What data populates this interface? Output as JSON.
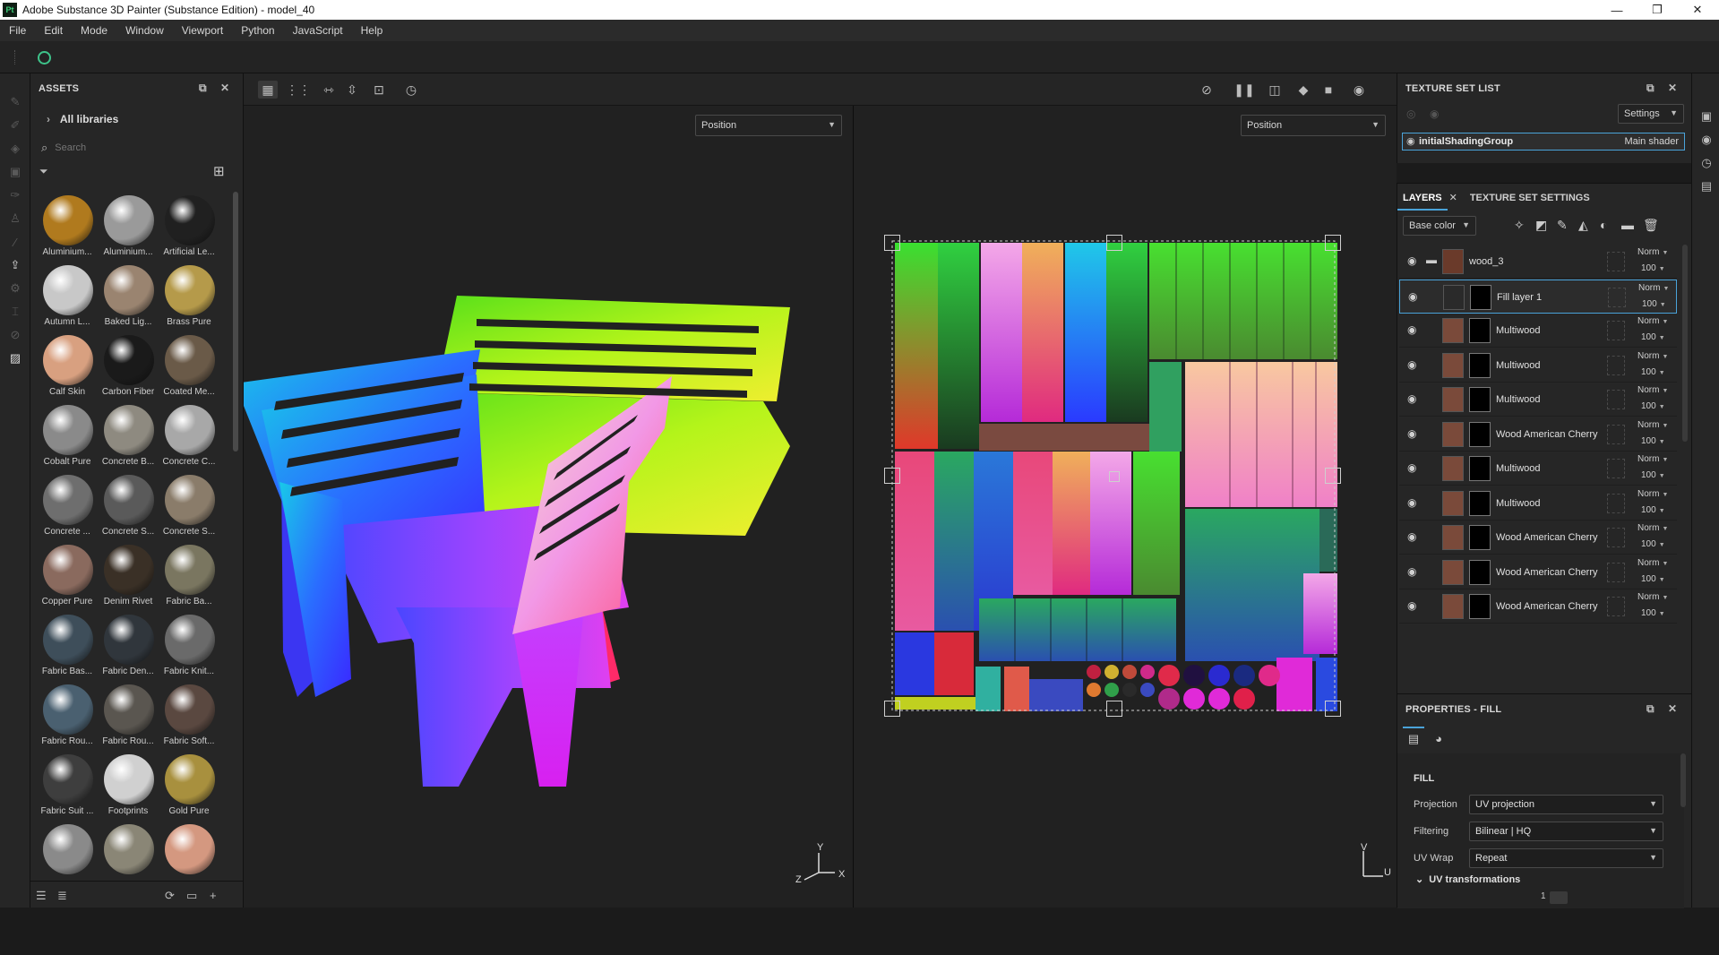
{
  "titlebar": {
    "logo": "Pt",
    "title": "Adobe Substance 3D Painter (Substance Edition) - model_40",
    "minimize": "—",
    "maximize": "❐",
    "close": "✕"
  },
  "menu": [
    "File",
    "Edit",
    "Mode",
    "Window",
    "Viewport",
    "Python",
    "JavaScript",
    "Help"
  ],
  "assets": {
    "title": "ASSETS",
    "library": "All libraries",
    "search_placeholder": "Search",
    "items": [
      {
        "label": "Aluminium...",
        "color": "#b07a1e"
      },
      {
        "label": "Aluminium...",
        "color": "#9a9a9a"
      },
      {
        "label": "Artificial Le...",
        "color": "#202020"
      },
      {
        "label": "Autumn L...",
        "color": "#c8c8c8"
      },
      {
        "label": "Baked Lig...",
        "color": "#9a8470"
      },
      {
        "label": "Brass Pure",
        "color": "#b59a4a"
      },
      {
        "label": "Calf Skin",
        "color": "#d8a080"
      },
      {
        "label": "Carbon Fiber",
        "color": "#1a1a1a"
      },
      {
        "label": "Coated Me...",
        "color": "#6a5a48"
      },
      {
        "label": "Cobalt Pure",
        "color": "#8a8a8a"
      },
      {
        "label": "Concrete B...",
        "color": "#8e8a80"
      },
      {
        "label": "Concrete C...",
        "color": "#a8a8a8"
      },
      {
        "label": "Concrete ...",
        "color": "#6e6e6e"
      },
      {
        "label": "Concrete S...",
        "color": "#5a5a5a"
      },
      {
        "label": "Concrete S...",
        "color": "#8a7c6a"
      },
      {
        "label": "Copper Pure",
        "color": "#8a6a5e"
      },
      {
        "label": "Denim Rivet",
        "color": "#3a3026"
      },
      {
        "label": "Fabric Ba...",
        "color": "#7a7660"
      },
      {
        "label": "Fabric Bas...",
        "color": "#3e4e5a"
      },
      {
        "label": "Fabric Den...",
        "color": "#30363c"
      },
      {
        "label": "Fabric Knit...",
        "color": "#6a6a6a"
      },
      {
        "label": "Fabric Rou...",
        "color": "#4a6070"
      },
      {
        "label": "Fabric Rou...",
        "color": "#5a5650"
      },
      {
        "label": "Fabric Soft...",
        "color": "#5a4840"
      },
      {
        "label": "Fabric Suit ...",
        "color": "#3e3e3e"
      },
      {
        "label": "Footprints",
        "color": "#d0d0d0"
      },
      {
        "label": "Gold Pure",
        "color": "#a8903e"
      },
      {
        "label": "",
        "color": "#8a8a8a"
      },
      {
        "label": "",
        "color": "#8a8676"
      },
      {
        "label": "",
        "color": "#d49880"
      }
    ]
  },
  "viewport": {
    "left_mode": "Position",
    "right_mode": "Position",
    "gizmo_3d": {
      "y": "Y",
      "z": "Z",
      "x": "X"
    },
    "gizmo_2d": {
      "v": "V",
      "u": "U"
    }
  },
  "texture_set_list": {
    "title": "TEXTURE SET LIST",
    "settings": "Settings",
    "set_name": "initialShadingGroup",
    "shader": "Main shader"
  },
  "layers": {
    "tabs": [
      "LAYERS",
      "TEXTURE SET SETTINGS"
    ],
    "channel": "Base color",
    "rows": [
      {
        "name": "wood_3",
        "blend": "Norm",
        "opacity": "100",
        "type": "folder"
      },
      {
        "name": "Fill layer 1",
        "blend": "Norm",
        "opacity": "100",
        "type": "fill"
      },
      {
        "name": "Multiwood",
        "blend": "Norm",
        "opacity": "100",
        "type": "mask"
      },
      {
        "name": "Multiwood",
        "blend": "Norm",
        "opacity": "100",
        "type": "mask"
      },
      {
        "name": "Multiwood",
        "blend": "Norm",
        "opacity": "100",
        "type": "mask"
      },
      {
        "name": "Wood American Cherry",
        "blend": "Norm",
        "opacity": "100",
        "type": "mask"
      },
      {
        "name": "Multiwood",
        "blend": "Norm",
        "opacity": "100",
        "type": "mask"
      },
      {
        "name": "Multiwood",
        "blend": "Norm",
        "opacity": "100",
        "type": "mask"
      },
      {
        "name": "Wood American Cherry",
        "blend": "Norm",
        "opacity": "100",
        "type": "mask"
      },
      {
        "name": "Wood American Cherry",
        "blend": "Norm",
        "opacity": "100",
        "type": "mask"
      },
      {
        "name": "Wood American Cherry",
        "blend": "Norm",
        "opacity": "100",
        "type": "mask"
      }
    ]
  },
  "properties": {
    "title": "PROPERTIES - FILL",
    "section": "FILL",
    "projection_label": "Projection",
    "projection": "UV projection",
    "filtering_label": "Filtering",
    "filtering": "Bilinear | HQ",
    "wrap_label": "UV Wrap",
    "wrap": "Repeat",
    "uv_transform": "UV transformations",
    "scale_value": "1"
  }
}
